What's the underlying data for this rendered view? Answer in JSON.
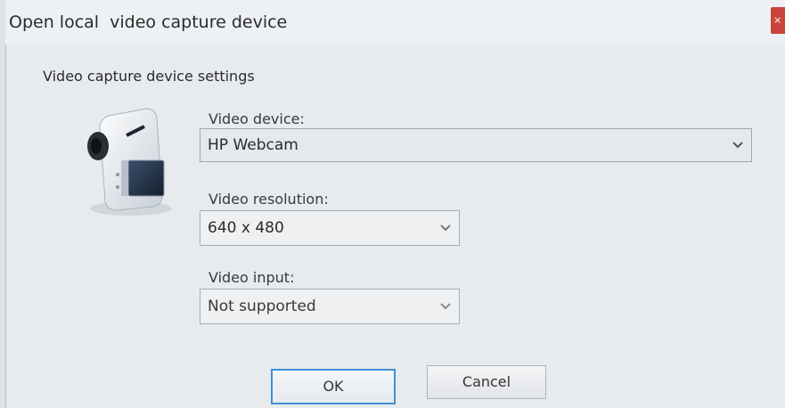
{
  "window": {
    "title": "Open local  video capture device",
    "close_glyph": "×"
  },
  "group": {
    "label": "Video capture device settings"
  },
  "video_device": {
    "label": "Video device:",
    "value": "HP Webcam"
  },
  "video_resolution": {
    "label": "Video resolution:",
    "value": "640 x 480"
  },
  "video_input": {
    "label": "Video input:",
    "value": "Not supported"
  },
  "buttons": {
    "ok": "OK",
    "cancel": "Cancel"
  },
  "icons": {
    "camera": "camcorder-icon",
    "dropdown": "chevron-down-icon"
  },
  "colors": {
    "accent": "#3f8fd6",
    "close": "#c9453b"
  }
}
